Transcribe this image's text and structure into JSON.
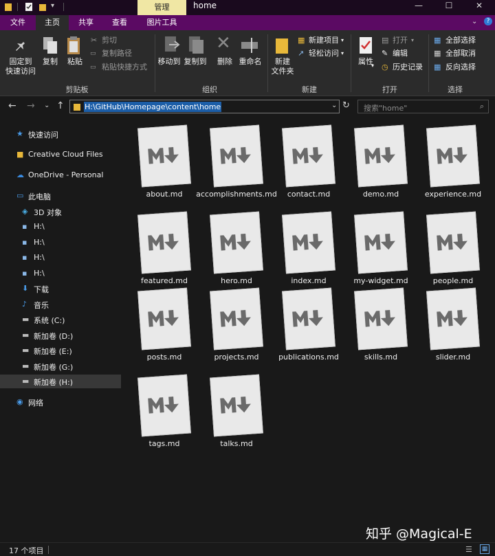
{
  "window": {
    "title": "home",
    "context_tab": "管理",
    "buttons": [
      "—",
      "☐",
      "✕"
    ]
  },
  "ribbon_tabs": [
    "文件",
    "主页",
    "共享",
    "查看",
    "图片工具"
  ],
  "ribbon": {
    "clipboard": {
      "pin": "固定到\n快速访问",
      "copy": "复制",
      "paste": "粘贴",
      "cut": "剪切",
      "copy_path": "复制路径",
      "paste_shortcut": "粘贴快捷方式",
      "label": "剪贴板"
    },
    "organize": {
      "move_to": "移动到",
      "copy_to": "复制到",
      "delete": "删除",
      "rename": "重命名",
      "label": "组织"
    },
    "new": {
      "new_folder": "新建\n文件夹",
      "new_item": "新建项目",
      "easy_access": "轻松访问",
      "label": "新建"
    },
    "open": {
      "properties": "属性",
      "open": "打开",
      "edit": "编辑",
      "history": "历史记录",
      "label": "打开"
    },
    "select": {
      "select_all": "全部选择",
      "select_none": "全部取消",
      "invert": "反向选择",
      "label": "选择"
    }
  },
  "address": {
    "path": "H:\\GitHub\\Homepage\\content\\home",
    "search_placeholder": "搜索\"home\""
  },
  "sidebar": [
    {
      "label": "快速访问",
      "icon": "star-icon"
    },
    {
      "label": "Creative Cloud Files",
      "icon": "folder-icon"
    },
    {
      "label": "OneDrive - Personal",
      "icon": "cloud-icon"
    },
    {
      "label": "此电脑",
      "icon": "computer-icon"
    },
    {
      "label": "3D 对象",
      "icon": "cube-icon"
    },
    {
      "label": "H:\\",
      "icon": "drive-icon"
    },
    {
      "label": "H:\\",
      "icon": "drive-icon"
    },
    {
      "label": "H:\\",
      "icon": "drive-icon"
    },
    {
      "label": "H:\\",
      "icon": "drive-icon"
    },
    {
      "label": "下载",
      "icon": "download-icon"
    },
    {
      "label": "音乐",
      "icon": "music-icon"
    },
    {
      "label": "系统 (C:)",
      "icon": "disk-icon"
    },
    {
      "label": "新加卷 (D:)",
      "icon": "disk-icon"
    },
    {
      "label": "新加卷 (E:)",
      "icon": "disk-icon"
    },
    {
      "label": "新加卷 (G:)",
      "icon": "disk-icon"
    },
    {
      "label": "新加卷 (H:)",
      "icon": "disk-icon"
    },
    {
      "label": "网络",
      "icon": "network-icon"
    }
  ],
  "files": [
    "about.md",
    "accomplishments.md",
    "contact.md",
    "demo.md",
    "experience.md",
    "featured.md",
    "hero.md",
    "index.md",
    "my-widget.md",
    "people.md",
    "posts.md",
    "projects.md",
    "publications.md",
    "skills.md",
    "slider.md",
    "tags.md",
    "talks.md"
  ],
  "status": {
    "count": "17 个项目"
  },
  "watermark": "知乎 @Magical-E",
  "colors": {
    "tab_bar": "#5b0a63",
    "title_bar": "#1a0a1e",
    "context_tab": "#f0e7a4",
    "selection": "#1c5ea8"
  }
}
